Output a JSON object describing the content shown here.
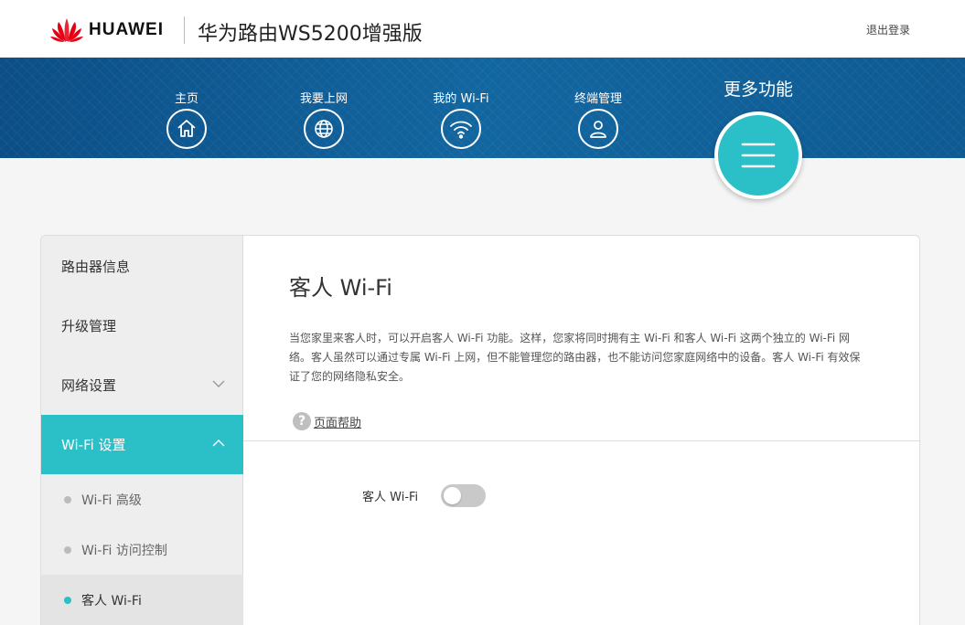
{
  "header": {
    "brand": "HUAWEI",
    "product": "华为路由WS5200增强版",
    "logout": "退出登录"
  },
  "nav": {
    "items": [
      {
        "label": "主页",
        "icon": "home-icon"
      },
      {
        "label": "我要上网",
        "icon": "globe-icon"
      },
      {
        "label": "我的 Wi-Fi",
        "icon": "wifi-icon"
      },
      {
        "label": "终端管理",
        "icon": "user-icon"
      }
    ],
    "more_label": "更多功能",
    "more_icon": "menu-icon",
    "accent": "#2bbfc7"
  },
  "sidebar": {
    "items": [
      {
        "label": "路由器信息"
      },
      {
        "label": "升级管理"
      },
      {
        "label": "网络设置",
        "expanded": false
      },
      {
        "label": "Wi-Fi 设置",
        "expanded": true,
        "active": true
      }
    ],
    "sub_items": [
      {
        "label": "Wi-Fi 高级"
      },
      {
        "label": "Wi-Fi 访问控制"
      },
      {
        "label": "客人 Wi-Fi",
        "current": true
      }
    ]
  },
  "content": {
    "title": "客人 Wi-Fi",
    "description": "当您家里来客人时，可以开启客人 Wi-Fi 功能。这样，您家将同时拥有主 Wi-Fi 和客人 Wi-Fi 这两个独立的 Wi-Fi 网络。客人虽然可以通过专属 Wi-Fi 上网，但不能管理您的路由器，也不能访问您家庭网络中的设备。客人 Wi-Fi 有效保证了您的网络隐私安全。",
    "help_label": "页面帮助",
    "toggle_label": "客人 Wi-Fi",
    "toggle_on": false
  }
}
